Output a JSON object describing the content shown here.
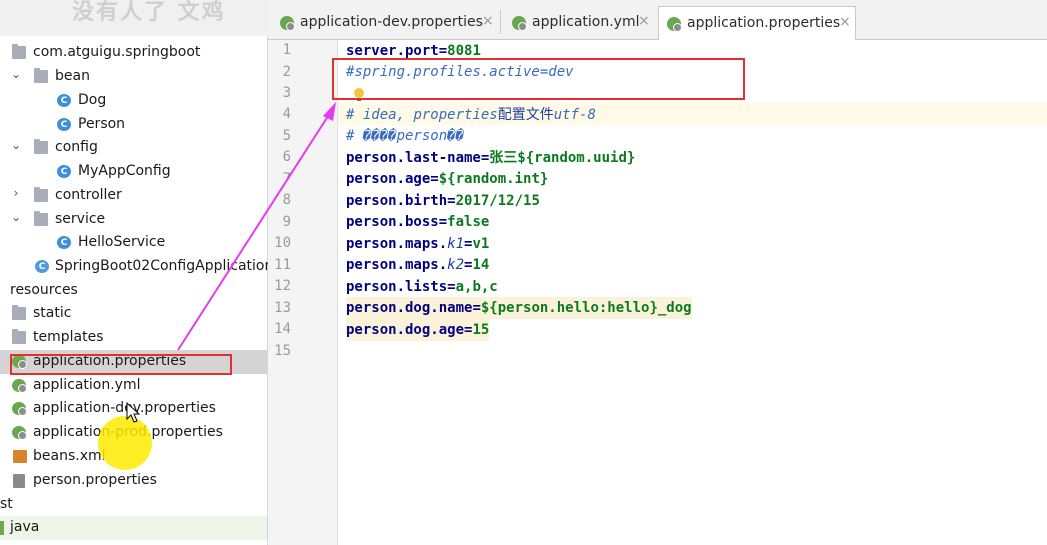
{
  "watermark": "没有人了 文鸡",
  "tabs": [
    {
      "label": "application-dev.properties",
      "active": false
    },
    {
      "label": "application.yml",
      "active": false
    },
    {
      "label": "application.properties",
      "active": true
    }
  ],
  "tree": {
    "package": "com.atguigu.springboot",
    "bean": "bean",
    "dog": "Dog",
    "person": "Person",
    "config": "config",
    "myappconfig": "MyAppConfig",
    "controller": "controller",
    "service": "service",
    "helloservice": "HelloService",
    "application_class": "SpringBoot02ConfigApplication",
    "resources": "resources",
    "static": "static",
    "templates": "templates",
    "app_props": "application.properties",
    "app_yml": "application.yml",
    "app_dev": "application-dev.properties",
    "app_prod": "application-prod.properties",
    "beans_xml": "beans.xml",
    "person_props": "person.properties",
    "st": "st",
    "java": "java"
  },
  "line_numbers": [
    "1",
    "2",
    "3",
    "4",
    "5",
    "6",
    "7",
    "8",
    "9",
    "10",
    "11",
    "12",
    "13",
    "14",
    "15"
  ],
  "code": {
    "l1_key": "server.port",
    "l1_val": "8081",
    "l2": "#spring.profiles.active=dev",
    "l4a": "# idea, ",
    "l4b": "properties",
    "l4c": "配置文件",
    "l4d": "utf-8",
    "l5a": "# ����",
    "l5b": "person",
    "l5c": "��",
    "l6_key": "person.last-name",
    "l6_val": "张三${random.uuid}",
    "l7_key": "person.age",
    "l7_val": "${random.int}",
    "l8_key": "person.birth",
    "l8_val": "2017/12/15",
    "l9_key": "person.boss",
    "l9_val": "false",
    "l10_key1": "person.maps.",
    "l10_key2": "k1",
    "l10_val": "v1",
    "l11_key1": "person.maps.",
    "l11_key2": "k2",
    "l11_val": "14",
    "l12_key": "person.lists",
    "l12_val": "a,b,c",
    "l13_key": "person.dog.name",
    "l13_val": "${person.hello:hello}_dog",
    "l14_key": "person.dog.age",
    "l14_val": "15",
    "eq": "="
  },
  "colors": {
    "annotation": "#e03030",
    "arrow": "#e23cf0",
    "cursor": "#ffeb00"
  }
}
